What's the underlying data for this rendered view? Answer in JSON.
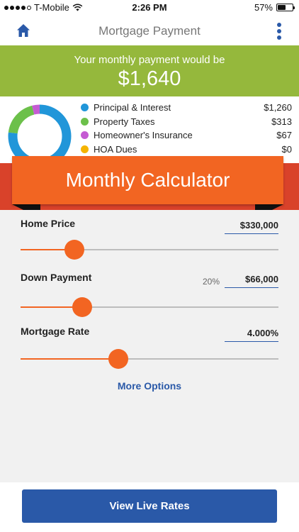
{
  "status_bar": {
    "carrier": "T-Mobile",
    "time": "2:26 PM",
    "battery": "57%",
    "battery_level": 0.57
  },
  "nav": {
    "title": "Mortgage Payment"
  },
  "summary": {
    "label": "Your monthly payment would be",
    "amount": "$1,640"
  },
  "breakdown": [
    {
      "name": "Principal & Interest",
      "value": "$1,260",
      "amount": 1260,
      "color": "#2196d9"
    },
    {
      "name": "Property Taxes",
      "value": "$313",
      "amount": 313,
      "color": "#6cc04a"
    },
    {
      "name": "Homeowner's Insurance",
      "value": "$67",
      "amount": 67,
      "color": "#c55bd3"
    },
    {
      "name": "HOA Dues",
      "value": "$0",
      "amount": 0,
      "color": "#f5b400"
    }
  ],
  "ribbon": {
    "title": "Monthly Calculator"
  },
  "calculator": {
    "home_price": {
      "label": "Home Price",
      "value": "$330,000",
      "slider": 0.21
    },
    "down_payment": {
      "label": "Down Payment",
      "percent": "20%",
      "value": "$66,000",
      "slider": 0.24
    },
    "mortgage_rate": {
      "label": "Mortgage Rate",
      "value": "4.000%",
      "slider": 0.38
    },
    "more_options": "More Options"
  },
  "footer": {
    "cta": "View Live Rates"
  },
  "colors": {
    "accent": "#f26522",
    "brand_blue": "#2a59a8",
    "summary_green": "#95b83c"
  }
}
